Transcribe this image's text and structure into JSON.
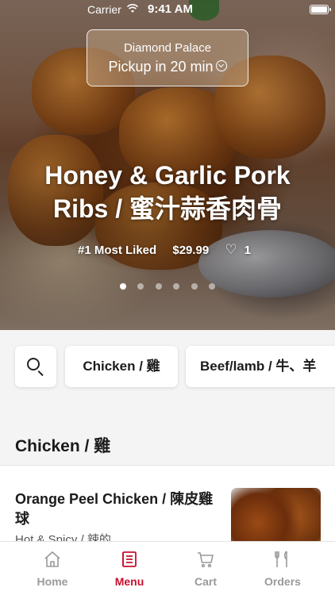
{
  "status_bar": {
    "carrier": "Carrier",
    "time": "9:41 AM"
  },
  "store": {
    "name": "Diamond Palace",
    "pickup": "Pickup in 20 min"
  },
  "featured": {
    "title": "Honey & Garlic Pork Ribs / 蜜汁蒜香肉骨",
    "rank": "#1 Most Liked",
    "price": "$29.99",
    "likes": "1",
    "slide_count": 6,
    "active_slide": 1
  },
  "categories": [
    {
      "label": "Chicken / 雞"
    },
    {
      "label": "Beef/lamb / 牛、羊"
    }
  ],
  "section": {
    "title": "Chicken / 雞"
  },
  "items": [
    {
      "name": "Orange Peel Chicken / 陳皮雞球",
      "description": "Hot & Spicy / 辣的"
    }
  ],
  "tabbar": {
    "active": "Menu",
    "accent_color": "#c8102e",
    "tabs": [
      {
        "label": "Home",
        "icon": "home-icon"
      },
      {
        "label": "Menu",
        "icon": "menu-icon"
      },
      {
        "label": "Cart",
        "icon": "cart-icon"
      },
      {
        "label": "Orders",
        "icon": "orders-icon"
      }
    ]
  }
}
